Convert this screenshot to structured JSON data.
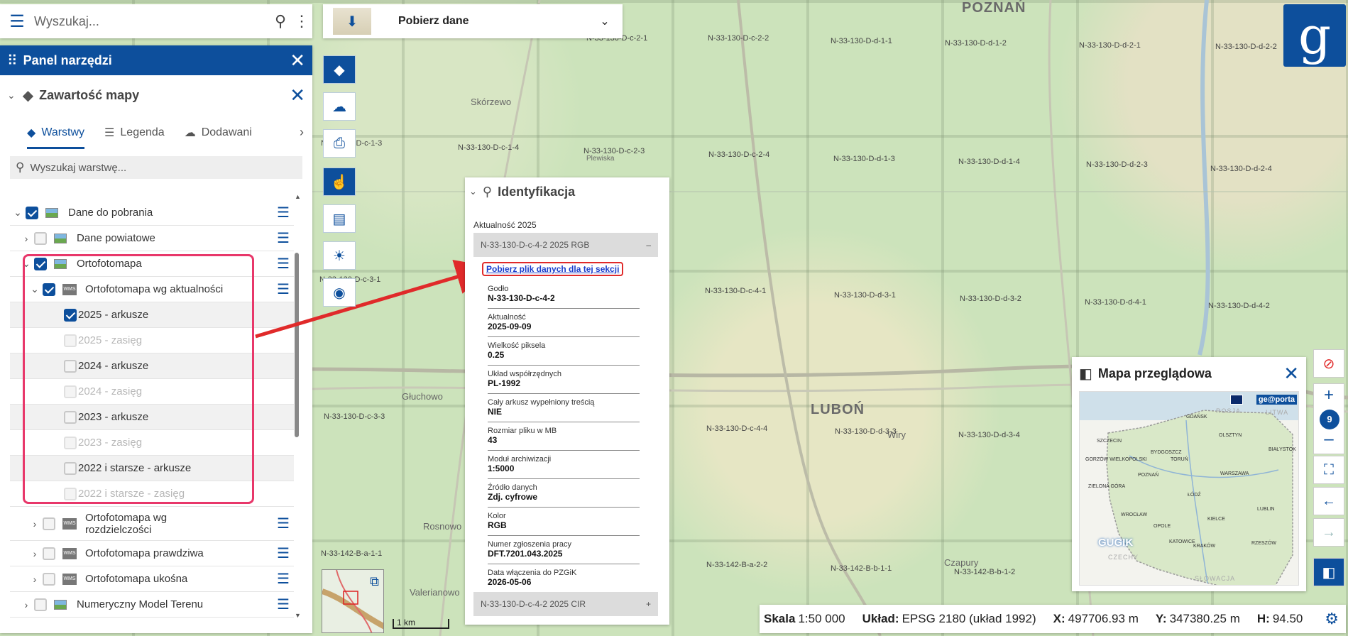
{
  "search": {
    "placeholder": "Wyszukaj..."
  },
  "panel": {
    "title": "Panel narzędzi",
    "section_title": "Zawartość mapy",
    "tabs": [
      {
        "label": "Warstwy",
        "active": true
      },
      {
        "label": "Legenda"
      },
      {
        "label": "Dodawani"
      }
    ],
    "layer_search_placeholder": "Wyszukaj warstwę...",
    "layers": [
      {
        "label": "Dane do pobrania",
        "checked": true
      },
      {
        "label": "Dane powiatowe",
        "checked": false
      },
      {
        "label": "Ortofotomapa",
        "checked": true
      },
      {
        "label": "Ortofotomapa wg aktualności",
        "checked": true
      },
      {
        "label": "2025 - arkusze",
        "checked": true
      },
      {
        "label": "2025 - zasięg",
        "disabled": true
      },
      {
        "label": "2024 - arkusze",
        "checked": false
      },
      {
        "label": "2024 - zasięg",
        "disabled": true
      },
      {
        "label": "2023 - arkusze",
        "checked": false
      },
      {
        "label": "2023 - zasięg",
        "disabled": true
      },
      {
        "label": "2022 i starsze - arkusze",
        "checked": false
      },
      {
        "label": "2022 i starsze - zasięg",
        "disabled": true
      },
      {
        "label1": "Ortofotomapa wg",
        "label2": "rozdzielczości",
        "checked": false
      },
      {
        "label": "Ortofotomapa prawdziwa",
        "checked": false
      },
      {
        "label": "Ortofotomapa ukośna",
        "checked": false
      },
      {
        "label": "Numeryczny Model Terenu",
        "checked": false
      }
    ]
  },
  "download": {
    "label": "Pobierz dane"
  },
  "ident": {
    "title": "Identyfikacja",
    "group": "Aktualność 2025",
    "item1": "N-33-130-D-c-4-2 2025 RGB",
    "item1_toggle": "–",
    "download_link": "Pobierz plik danych dla tej sekcji",
    "fields": [
      {
        "k": "Godło",
        "v": "N-33-130-D-c-4-2"
      },
      {
        "k": "Aktualność",
        "v": "2025-09-09"
      },
      {
        "k": "Wielkość piksela",
        "v": "0.25"
      },
      {
        "k": "Układ współrzędnych",
        "v": "PL-1992"
      },
      {
        "k": "Cały arkusz wypełniony treścią",
        "v": "NIE"
      },
      {
        "k": "Rozmiar pliku w MB",
        "v": "43"
      },
      {
        "k": "Moduł archiwizacji",
        "v": "1:5000"
      },
      {
        "k": "Źródło danych",
        "v": "Zdj. cyfrowe"
      },
      {
        "k": "Kolor",
        "v": "RGB"
      },
      {
        "k": "Numer zgłoszenia pracy",
        "v": "DFT.7201.043.2025"
      },
      {
        "k": "Data włączenia do PZGiK",
        "v": "2026-05-06"
      }
    ],
    "item2": "N-33-130-D-c-4-2 2025 CIR",
    "item2_toggle": "+"
  },
  "overview": {
    "title": "Mapa przeglądowa",
    "badge": "ge@porta",
    "watermark": "GUGIK",
    "countries": {
      "russia": "ROSJA",
      "lithuania": "LITWA",
      "czechia": "CZECHY",
      "slovakia": "SŁOWACJA"
    },
    "cities": [
      "GDAŃSK",
      "OLSZTYN",
      "SZCZECIN",
      "BYDGOSZCZ",
      "TORUŃ",
      "BIAŁYSTOK",
      "GORZÓW WIELKOPOLSKI",
      "POZNAŃ",
      "WARSZAWA",
      "ZIELONA GÓRA",
      "ŁÓDŹ",
      "WROCŁAW",
      "KIELCE",
      "LUBLIN",
      "OPOLE",
      "KATOWICE",
      "KRAKÓW",
      "RZESZÓW"
    ]
  },
  "zoom": {
    "level": "9"
  },
  "status": {
    "scale_label": "Skala",
    "scale_value": "1:50 000",
    "crs_label": "Układ:",
    "crs_value": "EPSG 2180 (układ 1992)",
    "x_label": "X:",
    "x_value": "497706.93 m",
    "y_label": "Y:",
    "y_value": "347380.25 m",
    "h_label": "H:",
    "h_value": "94.50"
  },
  "scalebar": "1 km",
  "map_labels": {
    "cities": [
      "POZNAŃ",
      "LUBOŃ"
    ],
    "villages": [
      "Skórzewo",
      "Głuchowo",
      "Wiry",
      "Czapury",
      "Rosnowo",
      "Valerianowo",
      "Plewiska"
    ],
    "sheets": [
      "N-33-130-D-c-2-1",
      "N-33-130-D-c-2-2",
      "N-33-130-D-d-1-1",
      "N-33-130-D-d-1-2",
      "N-33-130-D-d-2-1",
      "N-33-130-D-d-2-2",
      "N-33-130-D-c-1-3",
      "N-33-130-D-c-1-4",
      "N-33-130-D-c-2-3",
      "N-33-130-D-c-2-4",
      "N-33-130-D-d-1-3",
      "N-33-130-D-d-1-4",
      "N-33-130-D-d-2-3",
      "N-33-130-D-d-2-4",
      "N-33-130-D-c-3-1",
      "N-33-130-D-c-4-1",
      "N-33-130-D-d-3-1",
      "N-33-130-D-d-3-2",
      "N-33-130-D-d-4-1",
      "N-33-130-D-d-4-2",
      "N-33-130-D-c-3-3",
      "N-33-130-D-c-4-4",
      "N-33-130-D-d-3-3",
      "N-33-130-D-d-3-4",
      "N-33-142-B-a-1-1",
      "N-33-142-B-a-2-2",
      "N-33-142-B-b-1-1",
      "N-33-142-B-b-1-2"
    ]
  },
  "colors": {
    "primary": "#0d4f9c",
    "highlight": "#e8376a",
    "arrow": "#e02a2a"
  }
}
